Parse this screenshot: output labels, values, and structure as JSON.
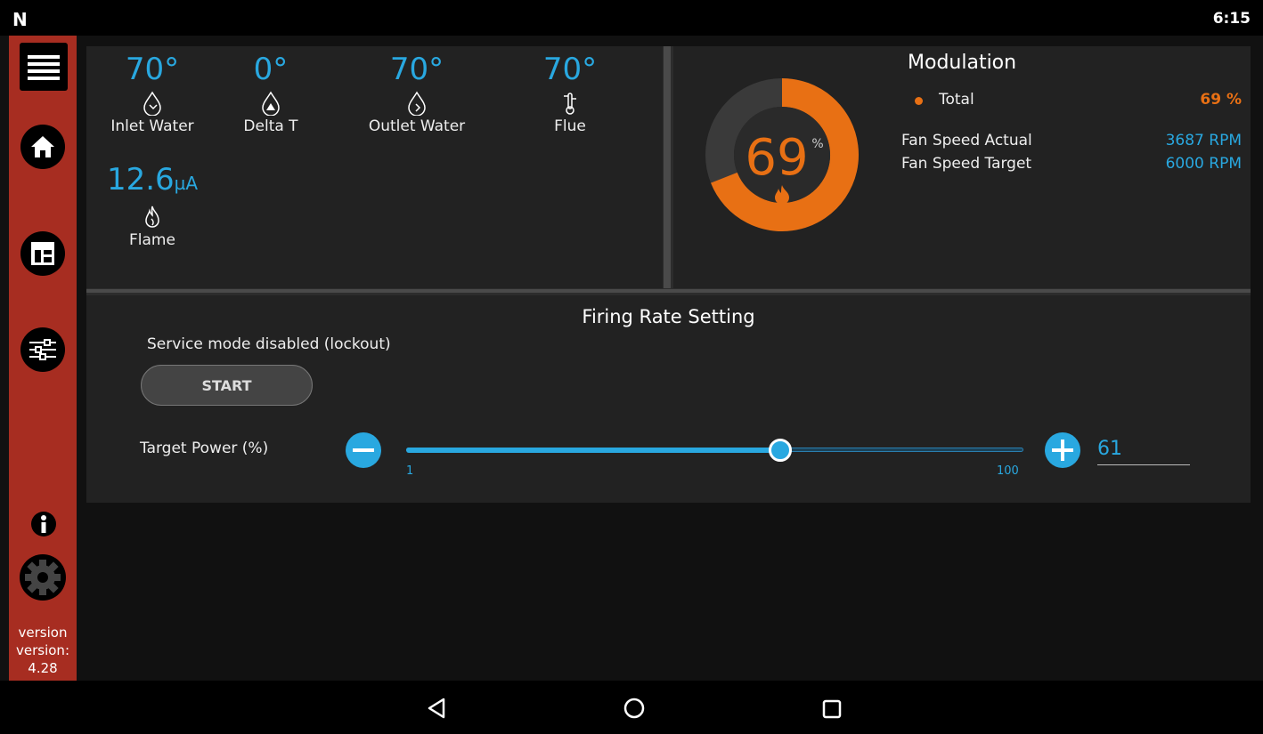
{
  "statusbar": {
    "logo": "N",
    "time": "6:15"
  },
  "sidebar": {
    "items": [
      {
        "name": "menu"
      },
      {
        "name": "home"
      },
      {
        "name": "dashboard"
      },
      {
        "name": "settings-sliders"
      },
      {
        "name": "info"
      },
      {
        "name": "gear"
      }
    ],
    "version_line1": "version",
    "version_line2": "version:",
    "version_number": "4.28"
  },
  "sensors": [
    {
      "value": "70°",
      "label": "Inlet Water",
      "icon": "water-drop-in-icon"
    },
    {
      "value": "0°",
      "label": "Delta T",
      "icon": "water-drop-delta-icon"
    },
    {
      "value": "70°",
      "label": "Outlet Water",
      "icon": "water-drop-out-icon"
    },
    {
      "value": "70°",
      "label": "Flue",
      "icon": "thermometer-icon"
    }
  ],
  "flame": {
    "value": "12.6",
    "unit": "µA",
    "label": "Flame",
    "icon": "flame-outline-icon"
  },
  "modulation": {
    "title": "Modulation",
    "gauge_value": "69",
    "gauge_unit": "%",
    "gauge_fraction": 0.69,
    "total_label": "Total",
    "total_value": "69 %",
    "fan_actual_label": "Fan Speed Actual",
    "fan_actual_value": "3687 RPM",
    "fan_target_label": "Fan Speed Target",
    "fan_target_value": "6000 RPM",
    "colors": {
      "accent": "#e87014",
      "track": "#3a3a3a"
    }
  },
  "firing": {
    "title": "Firing Rate Setting",
    "service_text": "Service mode disabled (lockout)",
    "start_label": "START",
    "target_label": "Target Power (%)",
    "slider_min_label": "1",
    "slider_max_label": "100",
    "slider_value": 61,
    "slider_min": 1,
    "slider_max": 100,
    "target_value": "61"
  },
  "navbar": {
    "items": [
      "back",
      "home",
      "recents"
    ]
  },
  "colors": {
    "accent_blue": "#29a8e0",
    "sidebar_red": "#a72d21",
    "orange": "#e87014"
  }
}
